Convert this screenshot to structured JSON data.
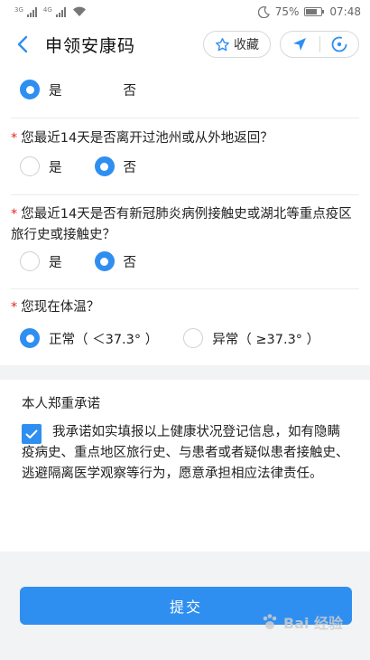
{
  "status_bar": {
    "network_1": "3G",
    "network_2": "4G",
    "battery": "75%",
    "time": "07:48",
    "battery_level": 0.75
  },
  "header": {
    "title": "申领安康码",
    "fav_label": "收藏"
  },
  "questions": [
    {
      "text": "",
      "required": false,
      "options": [
        {
          "label": "是",
          "selected": true
        },
        {
          "label": "否",
          "selected": false
        }
      ]
    },
    {
      "text": "您最近14天是否离开过池州或从外地返回？",
      "required": true,
      "options": [
        {
          "label": "是",
          "selected": false
        },
        {
          "label": "否",
          "selected": true
        }
      ]
    },
    {
      "text": "您最近14天是否有新冠肺炎病例接触史或湖北等重点疫区旅行史或接触史？",
      "required": true,
      "options": [
        {
          "label": "是",
          "selected": false
        },
        {
          "label": "否",
          "selected": true
        }
      ]
    },
    {
      "text": "您现在体温？",
      "required": true,
      "options": [
        {
          "label": "正常（ ＜37.3° ）",
          "selected": true
        },
        {
          "label": "异常（ ≥37.3° ）",
          "selected": false
        }
      ]
    }
  ],
  "promise": {
    "title": "本人郑重承诺",
    "text": "我承诺如实填报以上健康状况登记信息，如有隐瞒疫病史、重点地区旅行史、与患者或者疑似患者接触史、逃避隔离医学观察等行为，愿意承担相应法律责任。",
    "checked": true
  },
  "submit_label": "提交",
  "watermark": "Bai 经验",
  "colors": {
    "accent": "#2f8ff0",
    "required": "#e0281e"
  }
}
